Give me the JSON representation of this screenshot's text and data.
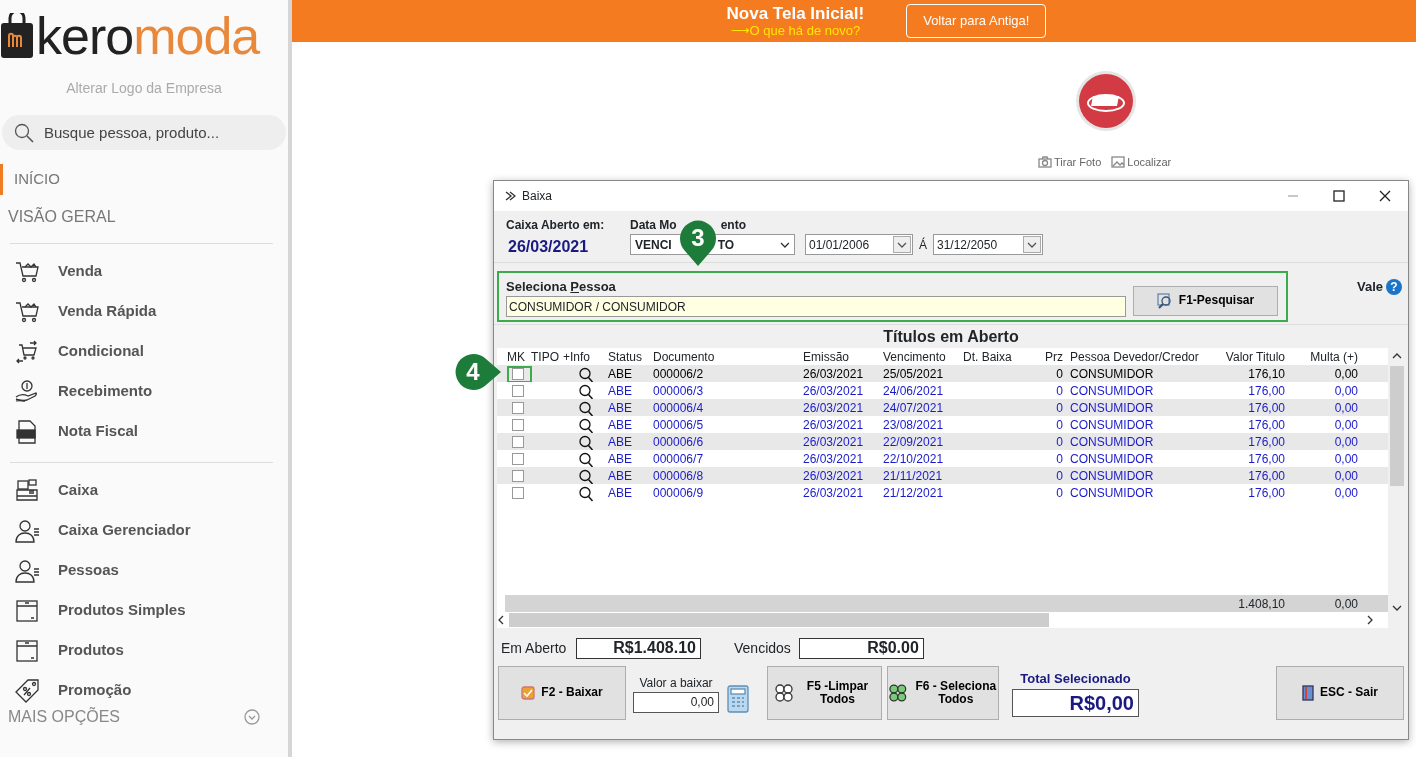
{
  "sidebar": {
    "logo": {
      "part_1": "kero",
      "part_2": "moda"
    },
    "change_logo_link": "Alterar Logo da Empresa",
    "search": {
      "placeholder": "Busque pessoa, produto..."
    },
    "sections": [
      {
        "label": "INÍCIO",
        "selected": true
      },
      {
        "label": "VISÃO GERAL",
        "selected": false
      }
    ],
    "groups": [
      [
        {
          "label": "Venda",
          "kind": "cart"
        },
        {
          "label": "Venda Rápida",
          "kind": "cart"
        },
        {
          "label": "Condicional",
          "kind": "swap"
        },
        {
          "label": "Recebimento",
          "kind": "hand"
        },
        {
          "label": "Nota Fiscal",
          "kind": "doc"
        }
      ],
      [
        {
          "label": "Caixa",
          "kind": "register"
        },
        {
          "label": "Caixa Gerenciador",
          "kind": "person"
        },
        {
          "label": "Pessoas",
          "kind": "person"
        },
        {
          "label": "Produtos Simples",
          "kind": "box"
        },
        {
          "label": "Produtos",
          "kind": "box"
        },
        {
          "label": "Promoção",
          "kind": "tag"
        }
      ]
    ],
    "more": "MAIS OPÇÕES"
  },
  "banner": {
    "title": "Nova Tela Inicial!",
    "subtitle": "⟶O que há de novo?",
    "button": "Voltar para Antiga!"
  },
  "profile": {
    "actions": [
      {
        "label": "Tirar Foto",
        "kind": "camera"
      },
      {
        "label": "Localizar",
        "kind": "image"
      }
    ]
  },
  "window": {
    "title": "Baixa",
    "caixa_label": "Caixa Aberto em:",
    "caixa_date": "26/03/2021",
    "data_label_parts": [
      "Data Mo",
      "ento"
    ],
    "select_parts": [
      "VENCI",
      "TO"
    ],
    "date_from": "01/01/2006",
    "date_sep": "Á",
    "date_to": "31/12/2050",
    "pessoa": {
      "label_parts": {
        "before": "Seleciona ",
        "accel": "P",
        "after": "essoa"
      },
      "value": "CONSUMIDOR / CONSUMIDOR",
      "button": "F1-Pesquisar",
      "highlighted": true
    },
    "vale": "Vale",
    "vale_help": "?",
    "table": {
      "title": "Títulos em Aberto",
      "columns": [
        "MK",
        "TIPO",
        "+Info",
        "Status",
        "Documento",
        "Emissão",
        "Vencimento",
        "Dt. Baixa",
        "Prz",
        "Pessoa Devedor/Credor",
        "Valor Titulo",
        "Multa (+)"
      ],
      "rows": [
        {
          "selected": true,
          "checked": false,
          "highlighted": true,
          "status": "ABE",
          "documento": "000006/2",
          "emissao": "26/03/2021",
          "vencimento": "25/05/2021",
          "prz": "0",
          "pessoa": "CONSUMIDOR",
          "valor": "176,10",
          "multa": "0,00"
        },
        {
          "selected": false,
          "checked": false,
          "highlighted": false,
          "status": "ABE",
          "documento": "000006/3",
          "emissao": "26/03/2021",
          "vencimento": "24/06/2021",
          "prz": "0",
          "pessoa": "CONSUMIDOR",
          "valor": "176,00",
          "multa": "0,00"
        },
        {
          "selected": false,
          "checked": false,
          "highlighted": false,
          "status": "ABE",
          "documento": "000006/4",
          "emissao": "26/03/2021",
          "vencimento": "24/07/2021",
          "prz": "0",
          "pessoa": "CONSUMIDOR",
          "valor": "176,00",
          "multa": "0,00"
        },
        {
          "selected": false,
          "checked": false,
          "highlighted": false,
          "status": "ABE",
          "documento": "000006/5",
          "emissao": "26/03/2021",
          "vencimento": "23/08/2021",
          "prz": "0",
          "pessoa": "CONSUMIDOR",
          "valor": "176,00",
          "multa": "0,00"
        },
        {
          "selected": false,
          "checked": false,
          "highlighted": false,
          "status": "ABE",
          "documento": "000006/6",
          "emissao": "26/03/2021",
          "vencimento": "22/09/2021",
          "prz": "0",
          "pessoa": "CONSUMIDOR",
          "valor": "176,00",
          "multa": "0,00"
        },
        {
          "selected": false,
          "checked": false,
          "highlighted": false,
          "status": "ABE",
          "documento": "000006/7",
          "emissao": "26/03/2021",
          "vencimento": "22/10/2021",
          "prz": "0",
          "pessoa": "CONSUMIDOR",
          "valor": "176,00",
          "multa": "0,00"
        },
        {
          "selected": false,
          "checked": false,
          "highlighted": false,
          "status": "ABE",
          "documento": "000006/8",
          "emissao": "26/03/2021",
          "vencimento": "21/11/2021",
          "prz": "0",
          "pessoa": "CONSUMIDOR",
          "valor": "176,00",
          "multa": "0,00"
        },
        {
          "selected": false,
          "checked": false,
          "highlighted": false,
          "status": "ABE",
          "documento": "000006/9",
          "emissao": "26/03/2021",
          "vencimento": "21/12/2021",
          "prz": "0",
          "pessoa": "CONSUMIDOR",
          "valor": "176,00",
          "multa": "0,00"
        }
      ],
      "totals": {
        "valor": "1.408,10",
        "multa": "0,00"
      }
    },
    "summary": {
      "em_aberto_label": "Em Aberto",
      "em_aberto": "R$1.408.10",
      "vencidos_label": "Vencidos",
      "vencidos": "R$0.00"
    },
    "actions": {
      "baixar": "F2 - Baixar",
      "valor_label": "Valor a baixar",
      "valor": "0,00",
      "limpar": "F5 -Limpar Todos",
      "seleciona": "F6 - Seleciona Todos",
      "total_label": "Total Selecionado",
      "total": "R$0,00",
      "sair": "ESC - Sair"
    }
  },
  "markers": [
    {
      "label": "3"
    },
    {
      "label": "4"
    }
  ]
}
